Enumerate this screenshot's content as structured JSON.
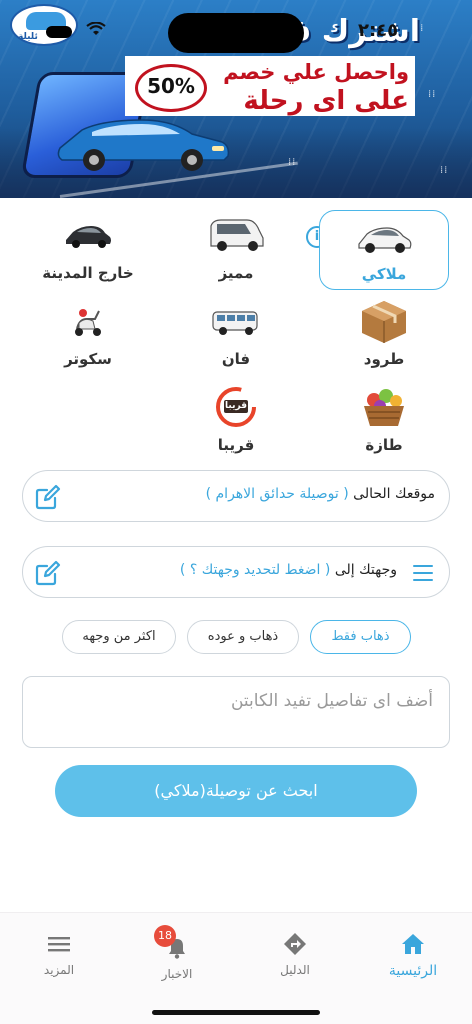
{
  "status_bar": {
    "time": "٢:٤٥"
  },
  "banner": {
    "headline": "اشترك ف... يلة",
    "logo_text": "ئليلة",
    "promo_line1": "واحصل علي خصم",
    "promo_line2": "على اى رحلة",
    "discount": "50%"
  },
  "services": [
    {
      "label": "ملاكي",
      "icon": "sedan-car-icon",
      "selected": true
    },
    {
      "label": "مميز",
      "icon": "van-car-icon"
    },
    {
      "label": "خارج المدينة",
      "icon": "dark-sedan-icon"
    },
    {
      "label": "طرود",
      "icon": "parcel-box-icon"
    },
    {
      "label": "فان",
      "icon": "minibus-icon"
    },
    {
      "label": "سكوتر",
      "icon": "scooter-icon"
    },
    {
      "label": "طازة",
      "icon": "vegetable-basket-icon"
    },
    {
      "label": "قريبا",
      "icon": "coming-soon-icon",
      "icon_text": "قريبا"
    }
  ],
  "location": {
    "current_label": "موقعك الحالى",
    "current_value": "( توصيلة حدائق الاهرام )",
    "destination_label": "وجهتك إلى",
    "destination_value": "( اضغط لتحديد وجهتك ؟ )"
  },
  "trip_types": [
    "ذهاب فقط",
    "ذهاب و عوده",
    "اكثر من وجهه"
  ],
  "notes": {
    "placeholder": "أضف اى تفاصيل تفيد الكابتن"
  },
  "search_button": "ابحث عن توصيلة(ملاكي)",
  "nav": {
    "home": "الرئيسية",
    "guide": "الدليل",
    "news": "الاخبار",
    "more": "المزيد",
    "news_badge": "18"
  },
  "colors": {
    "accent": "#3aa6dc",
    "button": "#5ec0ea",
    "promo_red": "#c1121f",
    "badge": "#e74c3c"
  }
}
